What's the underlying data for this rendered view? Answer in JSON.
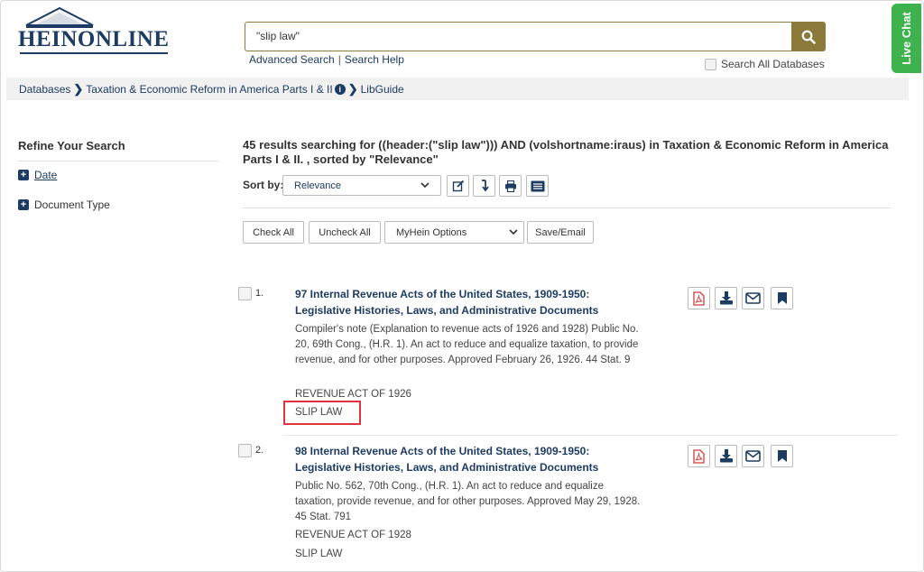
{
  "header": {
    "logo_text": "HEINONLINE",
    "search_value": "\"slip law\"",
    "advanced_search": "Advanced Search",
    "link_separator": "|",
    "search_help": "Search Help",
    "search_all_label": "Search All Databases",
    "live_chat": "Live Chat",
    "search_icon": "search-icon",
    "brand_color": "#1d3c63",
    "accent_color": "#8c7a3b",
    "chat_color": "#3eb24d"
  },
  "breadcrumb": {
    "items": [
      "Databases",
      "Taxation & Economic Reform in America Parts I & II",
      "LibGuide"
    ]
  },
  "sidebar": {
    "title": "Refine Your Search",
    "facets": [
      "Date",
      "Document Type"
    ]
  },
  "results": {
    "summary": "45 results searching for ((header:(\"slip law\"))) AND (volshortname:iraus) in Taxation & Economic Reform in America Parts I & II. , sorted by \"Relevance\"",
    "sort_label": "Sort by:",
    "sort_value": "Relevance",
    "tool_icons": [
      "edit-icon",
      "sort-download-icon",
      "print-icon",
      "list-view-icon"
    ],
    "buttons": {
      "check_all": "Check All",
      "uncheck_all": "Uncheck All",
      "myhein_options": "MyHein Options",
      "save_email": "Save/Email"
    },
    "items": [
      {
        "num": "1.",
        "title": "97 Internal Revenue Acts of the United States, 1909-1950: Legislative Histories, Laws, and Administrative Documents",
        "description": "Compiler's note (Explanation to revenue acts of 1926 and 1928) Public No. 20, 69th Cong., (H.R. 1). An act to reduce and equalize taxation, to provide revenue, and for other purposes. Approved February 26, 1926. 44 Stat. 9",
        "act": "REVENUE ACT OF 1926",
        "doc_type": "SLIP LAW",
        "highlight_color": "#e0333b"
      },
      {
        "num": "2.",
        "title": "98 Internal Revenue Acts of the United States, 1909-1950: Legislative Histories, Laws, and Administrative Documents",
        "description": "Public No. 562, 70th Cong., (H.R. 1). An act to reduce and equalize taxation, provide revenue, and for other purposes. Approved May 29, 1928. 45 Stat. 791",
        "act": "REVENUE ACT OF 1928",
        "doc_type": "SLIP LAW"
      }
    ],
    "item_action_icons": [
      "pdf-icon",
      "download-icon",
      "email-icon",
      "bookmark-icon"
    ]
  }
}
